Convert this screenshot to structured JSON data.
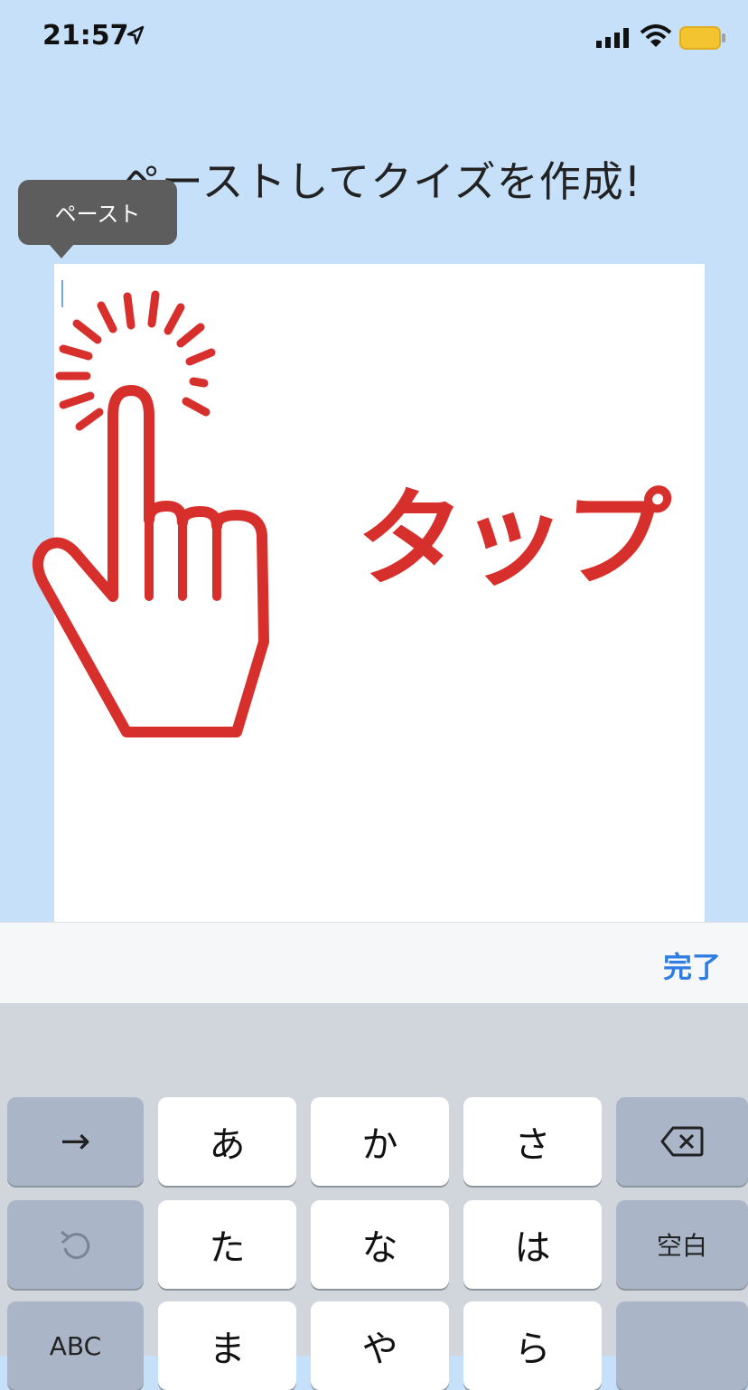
{
  "status_bar": {
    "time": "21:57"
  },
  "title": "ペーストしてクイズを作成!",
  "tooltip": {
    "label": "ペースト"
  },
  "overlay": {
    "tap_label": "タップ"
  },
  "accessory_bar": {
    "done_label": "完了"
  },
  "keyboard": {
    "rows": [
      [
        "→",
        "あ",
        "か",
        "さ",
        "⌫"
      ],
      [
        "↺",
        "た",
        "な",
        "は",
        "空白"
      ],
      [
        "ABC",
        "ま",
        "や",
        "ら",
        ""
      ]
    ]
  },
  "colors": {
    "background": "#c5e0f8",
    "accent_red": "#d7302c",
    "done_blue": "#2f7de1",
    "battery_yellow": "#f4c430"
  },
  "icons": [
    "location-arrow-icon",
    "signal-bars-icon",
    "wifi-icon",
    "battery-icon",
    "tap-hand-icon",
    "backspace-icon",
    "undo-icon"
  ]
}
